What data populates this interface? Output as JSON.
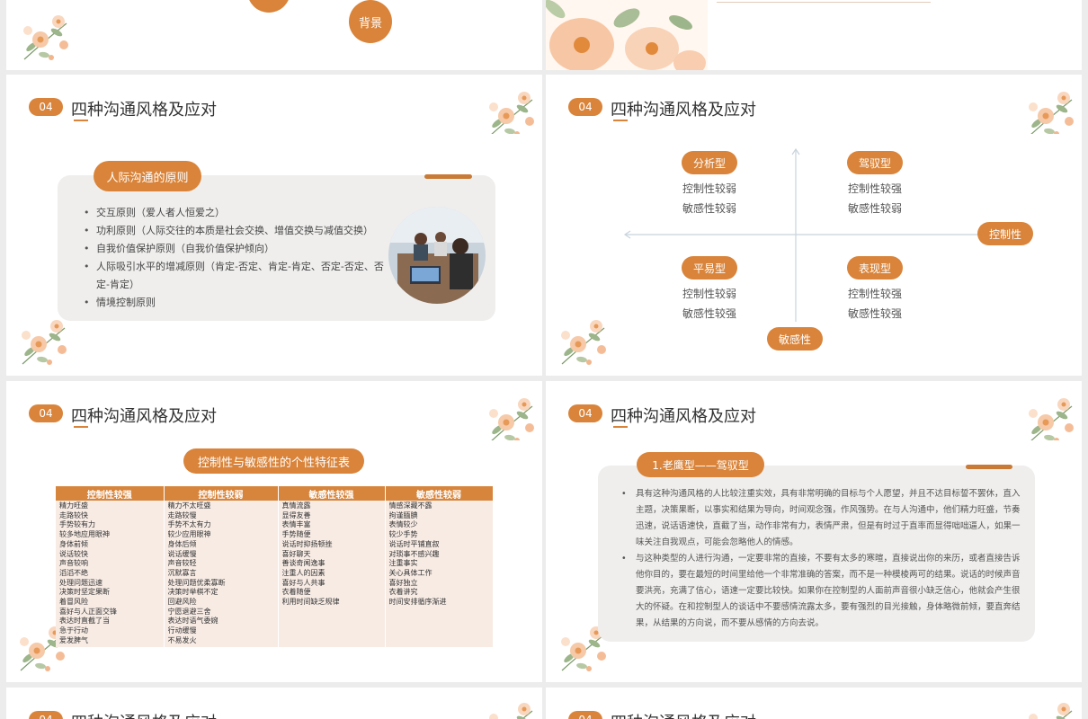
{
  "slide_top_left": {
    "badge_label": "背景"
  },
  "section_number": "04",
  "section_title": "四种沟通风格及应对",
  "slide_principles": {
    "header": "人际沟通的原则",
    "bullets": [
      "交互原则（爱人者人恒爱之）",
      "功利原则（人际交往的本质是社会交换、增值交换与减值交换）",
      "自我价值保护原则（自我价值保护倾向）",
      "人际吸引水平的增减原则（肯定-否定、肯定-肯定、否定-否定、否定-肯定）",
      "情境控制原则"
    ]
  },
  "slide_quadrant": {
    "axis_x_label": "控制性",
    "axis_y_label": "敏感性",
    "quadrants": [
      {
        "name": "分析型",
        "line1": "控制性较弱",
        "line2": "敏感性较弱"
      },
      {
        "name": "驾驭型",
        "line1": "控制性较强",
        "line2": "敏感性较弱"
      },
      {
        "name": "平易型",
        "line1": "控制性较弱",
        "line2": "敏感性较强"
      },
      {
        "name": "表现型",
        "line1": "控制性较强",
        "line2": "敏感性较强"
      }
    ]
  },
  "slide_table": {
    "header": "控制性与敏感性的个性特征表",
    "columns": [
      "控制性较强",
      "控制性较弱",
      "敏感性较强",
      "敏感性较弱"
    ],
    "rows": [
      [
        "精力旺盛",
        "走路较快",
        "手势较有力",
        "较多地应用眼神",
        "身体前倾",
        "说话较快",
        "声音较响",
        "滔滔不绝",
        "处理问题迅速",
        "决策时坚定果断",
        "着冒风险",
        "喜好与人正面交锋",
        "表达时直截了当",
        "急于行动",
        "爱发脾气"
      ],
      [
        "精力不太旺盛",
        "走路较慢",
        "手势不太有力",
        "较少应用眼神",
        "身体后倾",
        "说话缓慢",
        "声音较轻",
        "沉默寡言",
        "处理问题优柔寡断",
        "决策时举棋不定",
        "回避风险",
        "宁愿退避三舍",
        "表达时语气委婉",
        "行动缓慢",
        "不易发火"
      ],
      [
        "真情流露",
        "显得友善",
        "表情丰富",
        "手势随便",
        "说话时抑扬顿挫",
        "喜好聊天",
        "善谈奇闻逸事",
        "注重人的因素",
        "喜好与人共事",
        "衣着随便",
        "利用时间缺乏规律"
      ],
      [
        "情感深藏不露",
        "拘谨腼腆",
        "表情较少",
        "较少手势",
        "说话时平铺直叙",
        "对琐事不感兴趣",
        "注重事实",
        "关心具体工作",
        "喜好独立",
        "衣着讲究",
        "时间安排循序渐进"
      ]
    ]
  },
  "slide_eagle": {
    "header": "1.老鹰型——驾驭型",
    "paragraphs": [
      "具有这种沟通风格的人比较注重实效，具有非常明确的目标与个人愿望，并且不达目标誓不罢休，直入主题，决策果断，以事实和结果为导向，时间观念强，作风强势。在与人沟通中，他们精力旺盛，节奏迅速，说话语速快，直截了当，动作非常有力，表情严肃，但是有时过于直率而显得咄咄逼人，如果一味关注自我观点，可能会忽略他人的情感。",
      "与这种类型的人进行沟通，一定要非常的直接，不要有太多的寒暄，直接说出你的来历，或者直接告诉他你目的，要在最短的时间里给他一个非常准确的答案，而不是一种模棱两可的结果。说话的时候声音要洪亮，充满了信心，语速一定要比较快。如果你在控制型的人面前声音很小缺乏信心，他就会产生很大的怀疑。在和控制型人的谈话中不要感情流露太多，要有强烈的目光接触，身体略微前倾，要直奔结果，从结果的方向说，而不要从感情的方向去说。"
    ]
  },
  "colors": {
    "accent": "#d9843a",
    "card": "#efeeed",
    "table_cell": "#f7ebe4"
  }
}
